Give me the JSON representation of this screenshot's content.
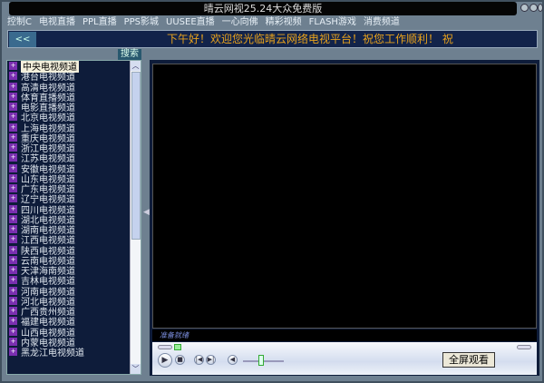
{
  "window": {
    "title": "晴云网视25.24大众免费版"
  },
  "menu": [
    "控制C",
    "电视直播",
    "PPL直播",
    "PPS影城",
    "UUSEE直播",
    "一心向佛",
    "精彩视频",
    "FLASH游戏",
    "消费频道"
  ],
  "banner": {
    "back_label": "<<",
    "marquee": "下午好！欢迎您光临晴云网络电视平台！祝您工作顺利！ 祝"
  },
  "search_label": "搜索",
  "channels": [
    "中央电视频道",
    "港台电视频道",
    "高清电视频道",
    "体育直播频道",
    "电影直播频道",
    "北京电视频道",
    "上海电视频道",
    "重庆电视频道",
    "浙江电视频道",
    "江苏电视频道",
    "安徽电视频道",
    "山东电视频道",
    "广东电视频道",
    "辽宁电视频道",
    "四川电视频道",
    "湖北电视频道",
    "湖南电视频道",
    "江西电视频道",
    "陕西电视频道",
    "云南电视频道",
    "天津海南频道",
    "吉林电视频道",
    "河南电视频道",
    "河北电视频道",
    "广西贵州频道",
    "福建电视频道",
    "山西电视频道",
    "内蒙电视频道",
    "黑龙江电视频道"
  ],
  "selected_channel": "中央电视频道",
  "player": {
    "status": "准备就绪",
    "fullscreen_label": "全屏观看",
    "volume": 0.45,
    "progress": 0.0
  }
}
